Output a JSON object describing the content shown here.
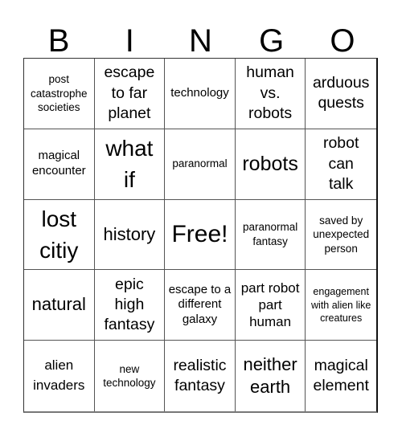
{
  "header": {
    "letters": [
      "B",
      "I",
      "N",
      "G",
      "O"
    ]
  },
  "cells": [
    {
      "text": "post catastrophe societies"
    },
    {
      "text": "escape to far planet"
    },
    {
      "text": "technology"
    },
    {
      "text": "human vs. robots"
    },
    {
      "text": "arduous quests"
    },
    {
      "text": "magical encounter"
    },
    {
      "text": "what if"
    },
    {
      "text": "paranormal"
    },
    {
      "text": "robots"
    },
    {
      "text": "robot can talk"
    },
    {
      "text": "lost citiy"
    },
    {
      "text": "history"
    },
    {
      "text": "Free!"
    },
    {
      "text": "paranormal fantasy"
    },
    {
      "text": "saved by unexpected person"
    },
    {
      "text": "natural"
    },
    {
      "text": "epic high fantasy"
    },
    {
      "text": "escape to a different galaxy"
    },
    {
      "text": "part robot part human"
    },
    {
      "text": "engagement with alien like creatures"
    },
    {
      "text": "alien invaders"
    },
    {
      "text": "new technology"
    },
    {
      "text": "realistic fantasy"
    },
    {
      "text": "neither earth"
    },
    {
      "text": "magical element"
    }
  ]
}
